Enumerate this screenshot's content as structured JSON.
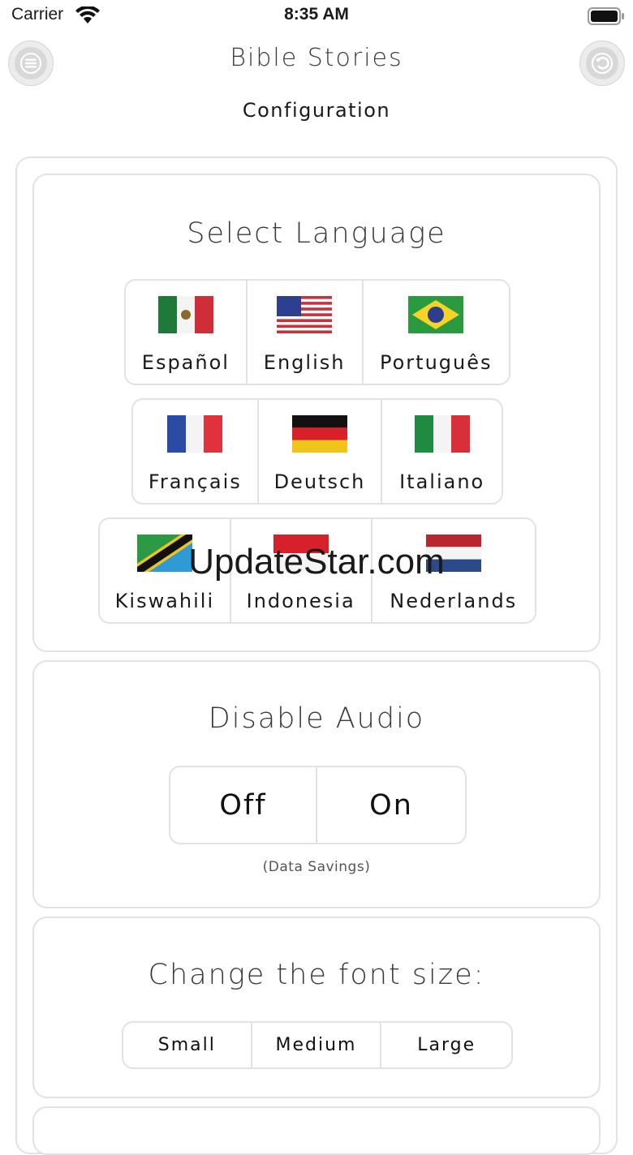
{
  "status_bar": {
    "carrier": "Carrier",
    "time": "8:35 AM",
    "icons": [
      "wifi-icon",
      "battery-icon"
    ]
  },
  "header": {
    "title": "Bible Stories",
    "subtitle": "Configuration",
    "left_icon": "menu-icon",
    "right_icon": "back-arrow-icon"
  },
  "language": {
    "title": "Select Language",
    "rows": [
      [
        {
          "label": "Español",
          "flag": "mexico"
        },
        {
          "label": "English",
          "flag": "usa"
        },
        {
          "label": "Português",
          "flag": "brazil"
        }
      ],
      [
        {
          "label": "Français",
          "flag": "france"
        },
        {
          "label": "Deutsch",
          "flag": "germany"
        },
        {
          "label": "Italiano",
          "flag": "italy"
        }
      ],
      [
        {
          "label": "Kiswahili",
          "flag": "tanzania"
        },
        {
          "label": "Indonesia",
          "flag": "indonesia"
        },
        {
          "label": "Nederlands",
          "flag": "netherlands"
        }
      ]
    ]
  },
  "audio": {
    "title": "Disable Audio",
    "options": [
      "Off",
      "On"
    ],
    "note": "(Data Savings)"
  },
  "font_size": {
    "title": "Change the font size:",
    "options": [
      "Small",
      "Medium",
      "Large"
    ]
  },
  "watermark": "UpdateStar.com",
  "colors": {
    "border": "#e2e2e2",
    "text": "#1a1a1a",
    "title": "#3a3a3a"
  }
}
